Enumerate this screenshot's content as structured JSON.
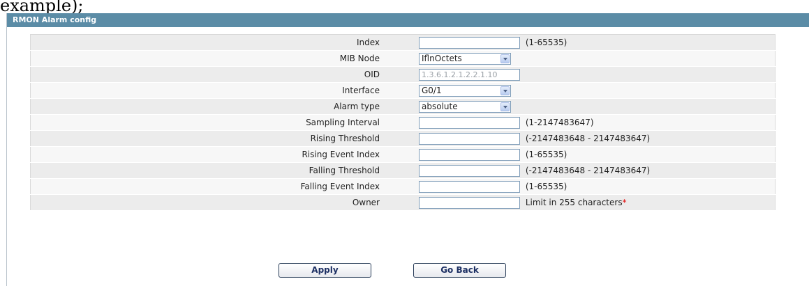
{
  "top_caption": "example);",
  "panel": {
    "title": "RMON Alarm config"
  },
  "form": {
    "rows": [
      {
        "label": "Index",
        "type": "text",
        "value": "",
        "hint": "(1-65535)"
      },
      {
        "label": "MIB Node",
        "type": "select",
        "value": "IflnOctets"
      },
      {
        "label": "OID",
        "type": "text",
        "value": "1.3.6.1.2.1.2.2.1.10",
        "disabled": true
      },
      {
        "label": "Interface",
        "type": "select",
        "value": "G0/1"
      },
      {
        "label": "Alarm type",
        "type": "select",
        "value": "absolute"
      },
      {
        "label": "Sampling Interval",
        "type": "text",
        "value": "",
        "hint": "(1-2147483647)"
      },
      {
        "label": "Rising Threshold",
        "type": "text",
        "value": "",
        "hint": "(-2147483648 - 2147483647)"
      },
      {
        "label": "Rising Event Index",
        "type": "text",
        "value": "",
        "hint": "(1-65535)"
      },
      {
        "label": "Falling Threshold",
        "type": "text",
        "value": "",
        "hint": "(-2147483648 - 2147483647)"
      },
      {
        "label": "Falling Event Index",
        "type": "text",
        "value": "",
        "hint": "(1-65535)"
      },
      {
        "label": "Owner",
        "type": "text",
        "value": "",
        "hint": "Limit in 255 characters",
        "required_mark": "*"
      }
    ]
  },
  "buttons": {
    "apply": "Apply",
    "go_back": "Go Back"
  },
  "colors": {
    "header_bg": "#5b8ca6",
    "required": "#e00000",
    "button_text": "#1c2f63"
  }
}
